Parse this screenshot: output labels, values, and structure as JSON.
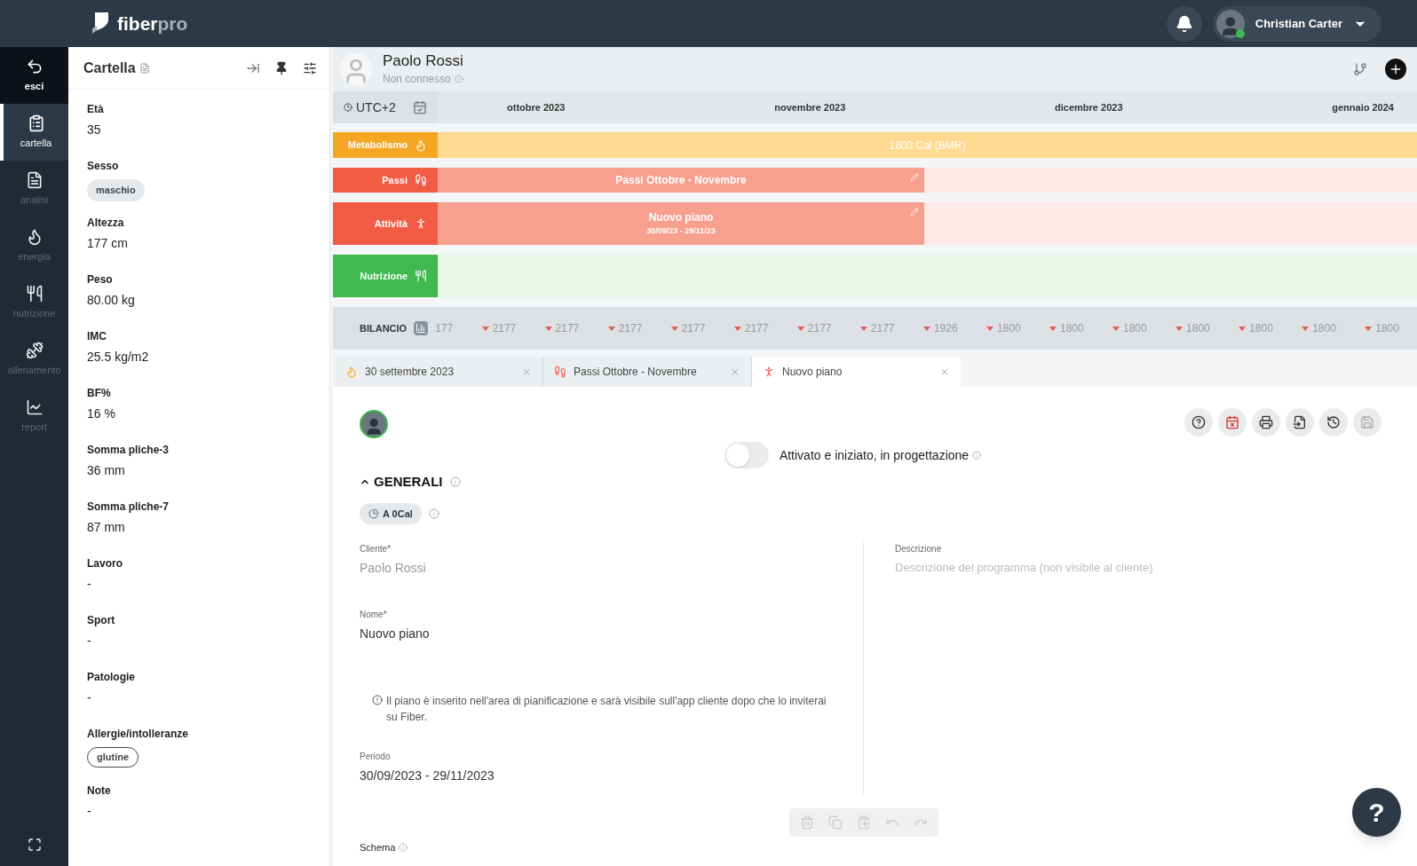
{
  "brand": {
    "name_a": "fiber",
    "name_b": "pro"
  },
  "user": {
    "name": "Christian Carter",
    "online": true
  },
  "nav": [
    {
      "label": "esci",
      "kind": "back",
      "selected": false
    },
    {
      "label": "cartella",
      "kind": "clipboard",
      "selected": true
    },
    {
      "label": "analisi",
      "kind": "doc",
      "selected": false
    },
    {
      "label": "energia",
      "kind": "flame",
      "selected": false
    },
    {
      "label": "nutrizione",
      "kind": "fork",
      "selected": false
    },
    {
      "label": "allenamento",
      "kind": "dumbbell",
      "selected": false
    },
    {
      "label": "report",
      "kind": "chart",
      "selected": false
    }
  ],
  "panel": {
    "title": "Cartella",
    "fields": [
      {
        "label": "Età",
        "value": "35",
        "kind": "text"
      },
      {
        "label": "Sesso",
        "value": "maschio",
        "kind": "chip"
      },
      {
        "label": "Altezza",
        "value": "177 cm",
        "kind": "text"
      },
      {
        "label": "Peso",
        "value": "80.00 kg",
        "kind": "text"
      },
      {
        "label": "IMC",
        "value": "25.5 kg/m2",
        "kind": "text"
      },
      {
        "label": "BF%",
        "value": "16 %",
        "kind": "text"
      },
      {
        "label": "Somma pliche-3",
        "value": "36 mm",
        "kind": "text"
      },
      {
        "label": "Somma pliche-7",
        "value": "87 mm",
        "kind": "text"
      },
      {
        "label": "Lavoro",
        "value": "-",
        "kind": "text"
      },
      {
        "label": "Sport",
        "value": "-",
        "kind": "text"
      },
      {
        "label": "Patologie",
        "value": "-",
        "kind": "text"
      },
      {
        "label": "Allergie/intolleranze",
        "value": "glutine",
        "kind": "outline-chip"
      },
      {
        "label": "Note",
        "value": "-",
        "kind": "text"
      }
    ]
  },
  "patient": {
    "name": "Paolo Rossi",
    "status": "Non connesso"
  },
  "timeline": {
    "timezone": "UTC+2",
    "months": [
      "ottobre 2023",
      "novembre 2023",
      "dicembre 2023",
      "gennaio 2024"
    ],
    "lanes": [
      {
        "label": "Metabolismo",
        "kind": "metabolism",
        "color": "#f5a623",
        "title": "1800 Cal (BMR)"
      },
      {
        "label": "Passi",
        "kind": "steps",
        "color": "#f25c45",
        "title": "Passi Ottobre - Novembre"
      },
      {
        "label": "Attività",
        "kind": "activity",
        "color": "#f25c45",
        "title": "Nuovo piano",
        "subtitle": "30/09/23 - 29/11/23"
      },
      {
        "label": "Nutrizione",
        "kind": "nutrition",
        "color": "#3fb950"
      }
    ]
  },
  "balance": {
    "label": "BILANCIO",
    "values": [
      {
        "value": "177",
        "down": false
      },
      {
        "value": "2177",
        "down": true
      },
      {
        "value": "2177",
        "down": true
      },
      {
        "value": "2177",
        "down": true
      },
      {
        "value": "2177",
        "down": true
      },
      {
        "value": "2177",
        "down": true
      },
      {
        "value": "2177",
        "down": true
      },
      {
        "value": "2177",
        "down": true
      },
      {
        "value": "1926",
        "down": true
      },
      {
        "value": "1800",
        "down": true
      },
      {
        "value": "1800",
        "down": true
      },
      {
        "value": "1800",
        "down": true
      },
      {
        "value": "1800",
        "down": true
      },
      {
        "value": "1800",
        "down": true
      },
      {
        "value": "1800",
        "down": true
      },
      {
        "value": "1800",
        "down": true
      }
    ]
  },
  "tabs": [
    {
      "label": "30 settembre 2023",
      "kind": "metabolism",
      "selected": false
    },
    {
      "label": "Passi Ottobre - Novembre",
      "kind": "steps",
      "selected": false
    },
    {
      "label": "Nuovo piano",
      "kind": "activity",
      "selected": true
    }
  ],
  "form": {
    "toggle": {
      "label": "Attivato e iniziato, in progettazione",
      "on": false
    },
    "section": "GENERALI",
    "expanded": true,
    "badge": "A 0Cal",
    "client": {
      "label": "Cliente*",
      "value": "Paolo Rossi",
      "disabled": true
    },
    "name": {
      "label": "Nome*",
      "value": "Nuovo piano"
    },
    "note": "Il piano è inserito nell'area di pianificazione e sarà visibile sull'app cliente dopo che lo inviterai su Fiber.",
    "period": {
      "label": "Periodo",
      "value": "30/09/2023 - 29/11/2023"
    },
    "description": {
      "label": "Descrizione",
      "placeholder": "Descrizione del programma (non visibile al cliente)"
    },
    "schema": "Schema"
  },
  "help_fab": "?"
}
